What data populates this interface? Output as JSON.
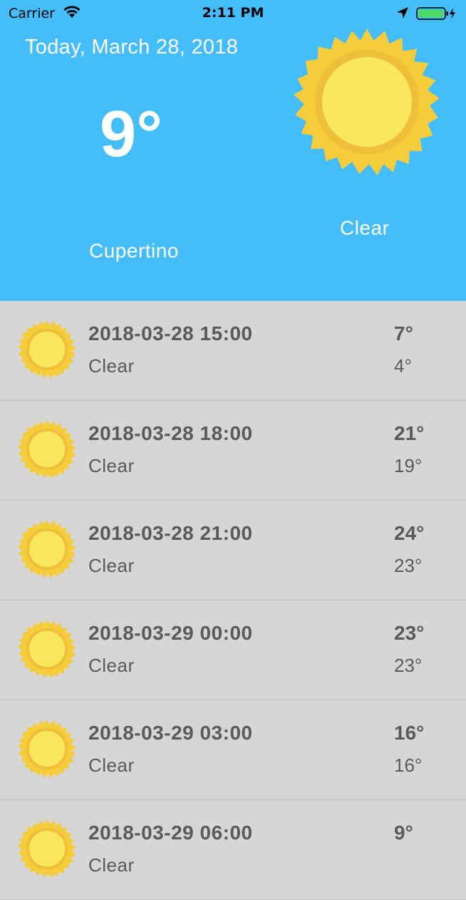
{
  "status_bar": {
    "carrier": "Carrier",
    "time": "2:11 PM",
    "wifi_icon": "wifi-icon",
    "location_icon": "location-arrow-icon",
    "battery_icon": "battery-charging-icon",
    "battery_color": "#4cd964"
  },
  "header": {
    "date": "Today, March 28, 2018",
    "temperature": "9°",
    "city": "Cupertino",
    "condition": "Clear",
    "icon": "sun-icon",
    "background": "#45bdfb"
  },
  "forecast": [
    {
      "time": "2018-03-28 15:00",
      "condition": "Clear",
      "high": "7°",
      "low": "4°",
      "icon": "sun-icon"
    },
    {
      "time": "2018-03-28 18:00",
      "condition": "Clear",
      "high": "21°",
      "low": "19°",
      "icon": "sun-icon"
    },
    {
      "time": "2018-03-28 21:00",
      "condition": "Clear",
      "high": "24°",
      "low": "23°",
      "icon": "sun-icon"
    },
    {
      "time": "2018-03-29 00:00",
      "condition": "Clear",
      "high": "23°",
      "low": "23°",
      "icon": "sun-icon"
    },
    {
      "time": "2018-03-29 03:00",
      "condition": "Clear",
      "high": "16°",
      "low": "16°",
      "icon": "sun-icon"
    },
    {
      "time": "2018-03-29 06:00",
      "condition": "Clear",
      "high": "9°",
      "low": "",
      "icon": "sun-icon"
    }
  ]
}
